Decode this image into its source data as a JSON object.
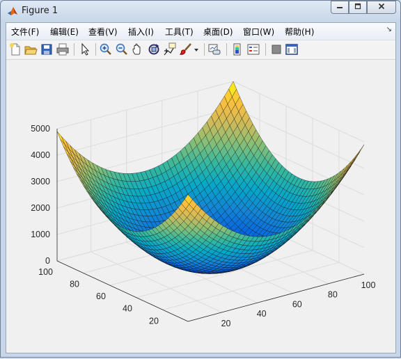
{
  "window": {
    "title": "Figure 1",
    "minimize_icon": "minimize-icon",
    "maximize_icon": "restore-icon",
    "close_icon": "close-icon"
  },
  "menu": {
    "items": [
      "文件(F)",
      "编辑(E)",
      "查看(V)",
      "插入(I)",
      "工具(T)",
      "桌面(D)",
      "窗口(W)",
      "帮助(H)"
    ],
    "overflow_icon": "dock-arrow-icon"
  },
  "toolbar": {
    "buttons": [
      "new-figure-icon",
      "open-file-icon",
      "save-icon",
      "print-icon",
      "pointer-icon",
      "zoom-in-icon",
      "zoom-out-icon",
      "pan-hand-icon",
      "rotate-3d-icon",
      "data-cursor-icon",
      "brush-icon",
      "brush-dropdown-icon",
      "link-plot-icon",
      "colorbar-icon",
      "legend-icon",
      "hide-plot-tools-icon",
      "show-plot-tools-icon"
    ]
  },
  "chart_data": {
    "type": "surface",
    "function": "z = (x-50)^2 + (y-50)^2",
    "x_range": [
      1,
      100
    ],
    "y_range": [
      1,
      100
    ],
    "z_range": [
      0,
      5000
    ],
    "z_ticks": [
      "0",
      "1000",
      "2000",
      "3000",
      "4000",
      "5000"
    ],
    "x_ticks": [
      "20",
      "40",
      "60",
      "80",
      "100"
    ],
    "y_ticks": [
      "20",
      "40",
      "60",
      "80",
      "100"
    ],
    "colormap": "parula",
    "grid": true
  }
}
